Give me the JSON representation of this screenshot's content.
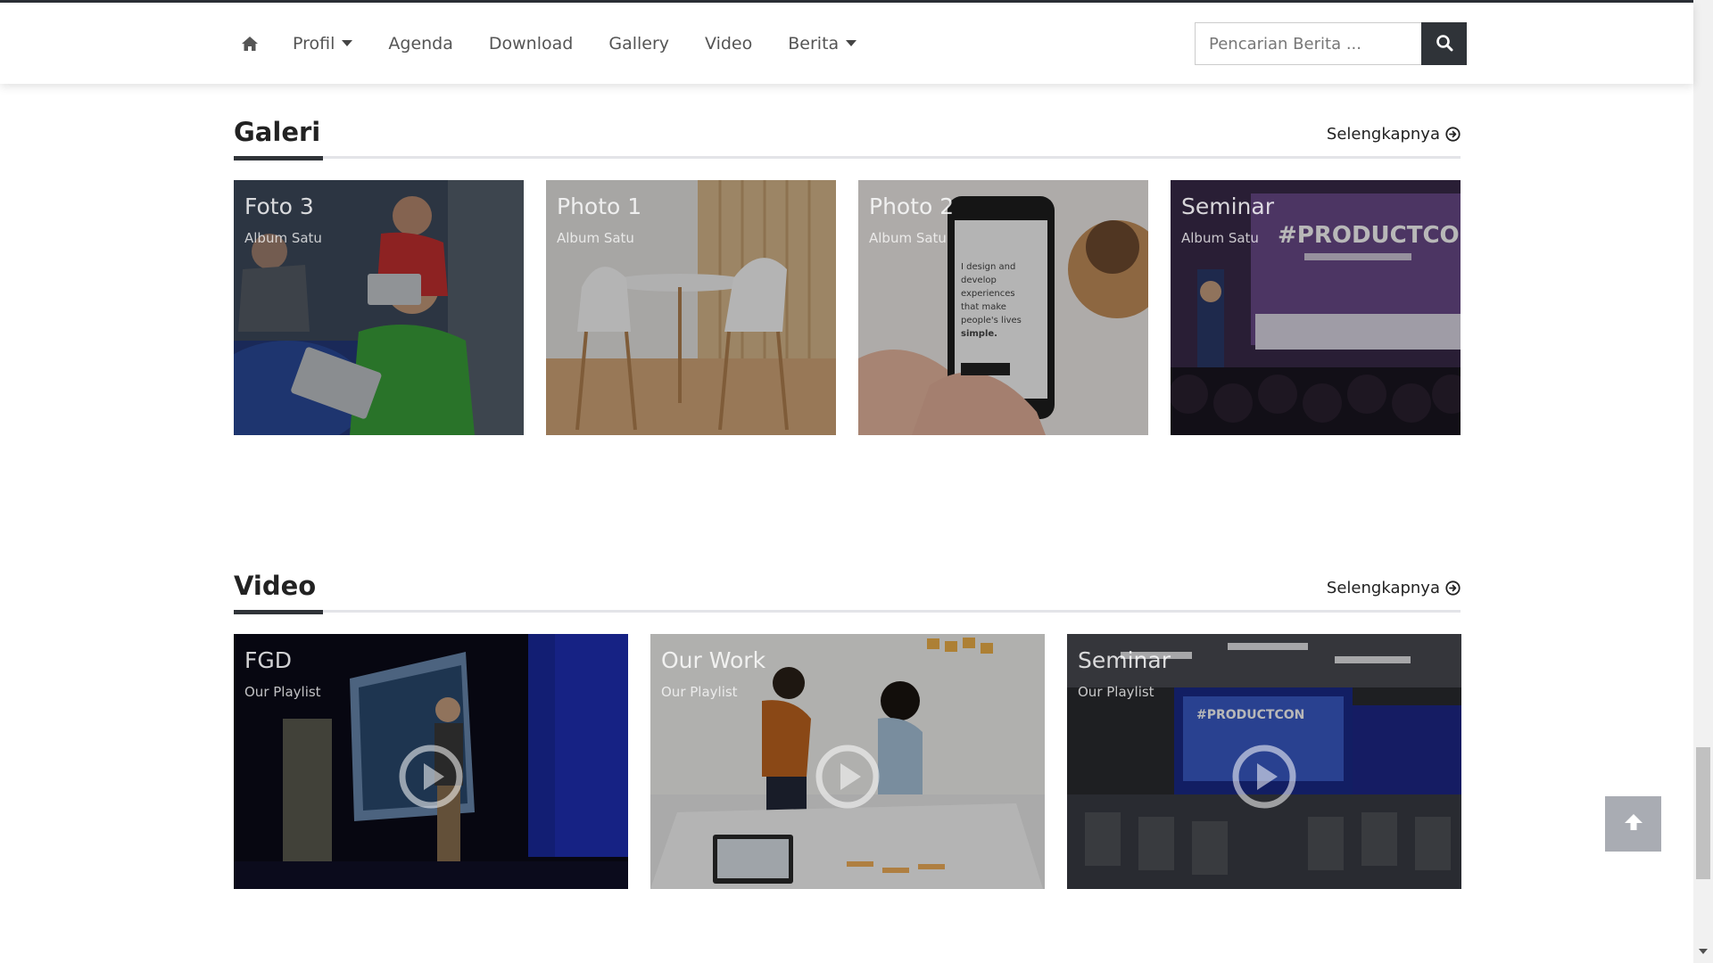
{
  "nav": {
    "items": [
      {
        "label": "Profil",
        "dropdown": true
      },
      {
        "label": "Agenda",
        "dropdown": false
      },
      {
        "label": "Download",
        "dropdown": false
      },
      {
        "label": "Gallery",
        "dropdown": false
      },
      {
        "label": "Video",
        "dropdown": false
      },
      {
        "label": "Berita",
        "dropdown": true
      }
    ],
    "search_placeholder": "Pencarian Berita ..."
  },
  "gallery": {
    "title": "Galeri",
    "more": "Selengkapnya",
    "items": [
      {
        "title": "Foto 3",
        "subtitle": "Album Satu"
      },
      {
        "title": "Photo 1",
        "subtitle": "Album Satu"
      },
      {
        "title": "Photo 2",
        "subtitle": "Album Satu"
      },
      {
        "title": "Seminar",
        "subtitle": "Album Satu"
      }
    ]
  },
  "video": {
    "title": "Video",
    "more": "Selengkapnya",
    "items": [
      {
        "title": "FGD",
        "subtitle": "Our Playlist"
      },
      {
        "title": "Our Work",
        "subtitle": "Our Playlist"
      },
      {
        "title": "Seminar",
        "subtitle": "Our Playlist"
      }
    ]
  },
  "colors": {
    "dark": "#2f3338",
    "rule": "#e3e4e8",
    "to_top": "#a9acb3"
  },
  "icons": {
    "home": "home-icon",
    "search": "search-icon",
    "more": "circle-arrow-right-icon",
    "play": "play-circle-icon",
    "to_top": "arrow-up-icon"
  }
}
